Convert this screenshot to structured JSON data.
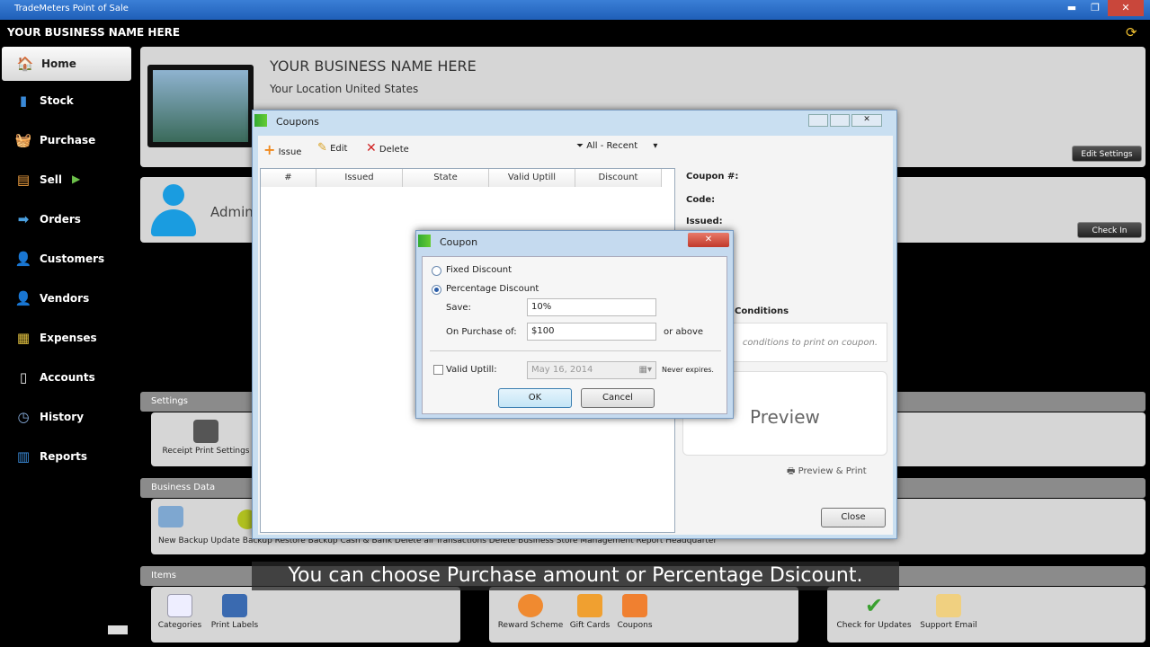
{
  "window": {
    "title": "TradeMeters Point of Sale",
    "min": "▬",
    "max": "❐",
    "close": "✕"
  },
  "business": {
    "name": "YOUR BUSINESS NAME HERE",
    "location": "Your Location United States"
  },
  "sidebar": {
    "items": [
      {
        "label": "Home",
        "icon": "🏠"
      },
      {
        "label": "Stock",
        "icon": "▮"
      },
      {
        "label": "Purchase",
        "icon": "🧺"
      },
      {
        "label": "Sell",
        "icon": "▤",
        "arrow": "▶"
      },
      {
        "label": "Orders",
        "icon": "➡"
      },
      {
        "label": "Customers",
        "icon": "👤"
      },
      {
        "label": "Vendors",
        "icon": "👤"
      },
      {
        "label": "Expenses",
        "icon": "▦"
      },
      {
        "label": "Accounts",
        "icon": "▯"
      },
      {
        "label": "History",
        "icon": "◷"
      },
      {
        "label": "Reports",
        "icon": "▥"
      }
    ]
  },
  "home": {
    "admin_label": "Admin",
    "edit_settings": "Edit Settings",
    "check_in": "Check In",
    "sections": {
      "settings": "Settings",
      "business_data": "Business Data",
      "items": "Items"
    },
    "settings_items": [
      "Receipt Print Settings"
    ],
    "business_items": "New Backup   Update Backup   Restore Backup   Cash & Bank   Delete all Transactions   Delete Business   Store Management   Report Headquarter",
    "items_left": [
      "Categories",
      "Print Labels"
    ],
    "items_mid": [
      "Reward Scheme",
      "Gift Cards",
      "Coupons"
    ],
    "items_right": [
      "Check for Updates",
      "Support Email"
    ]
  },
  "coupons": {
    "title": "Coupons",
    "toolbar": {
      "issue": "Issue",
      "edit": "Edit",
      "delete": "Delete",
      "filter": "All - Recent"
    },
    "columns": [
      "#",
      "Issued",
      "State",
      "Valid Uptill",
      "Discount"
    ],
    "details": {
      "coupon_no": "Coupon #:",
      "code": "Code:",
      "issued": "Issued:",
      "conditions": "Conditions",
      "conditions_hint": "conditions to print on coupon."
    },
    "preview": "Preview",
    "preview_print": "Preview & Print",
    "close": "Close"
  },
  "coupon_dialog": {
    "title": "Coupon",
    "fixed": "Fixed Discount",
    "percentage": "Percentage Discount",
    "save_label": "Save:",
    "save_value": "10%",
    "purchase_label": "On Purchase of:",
    "purchase_value": "$100",
    "or_above": "or above",
    "valid_label": "Valid Uptill:",
    "valid_value": "May 16, 2014",
    "never": "Never expires.",
    "ok": "OK",
    "cancel": "Cancel"
  },
  "subtitle": "You can choose Purchase amount or Percentage Dsicount."
}
